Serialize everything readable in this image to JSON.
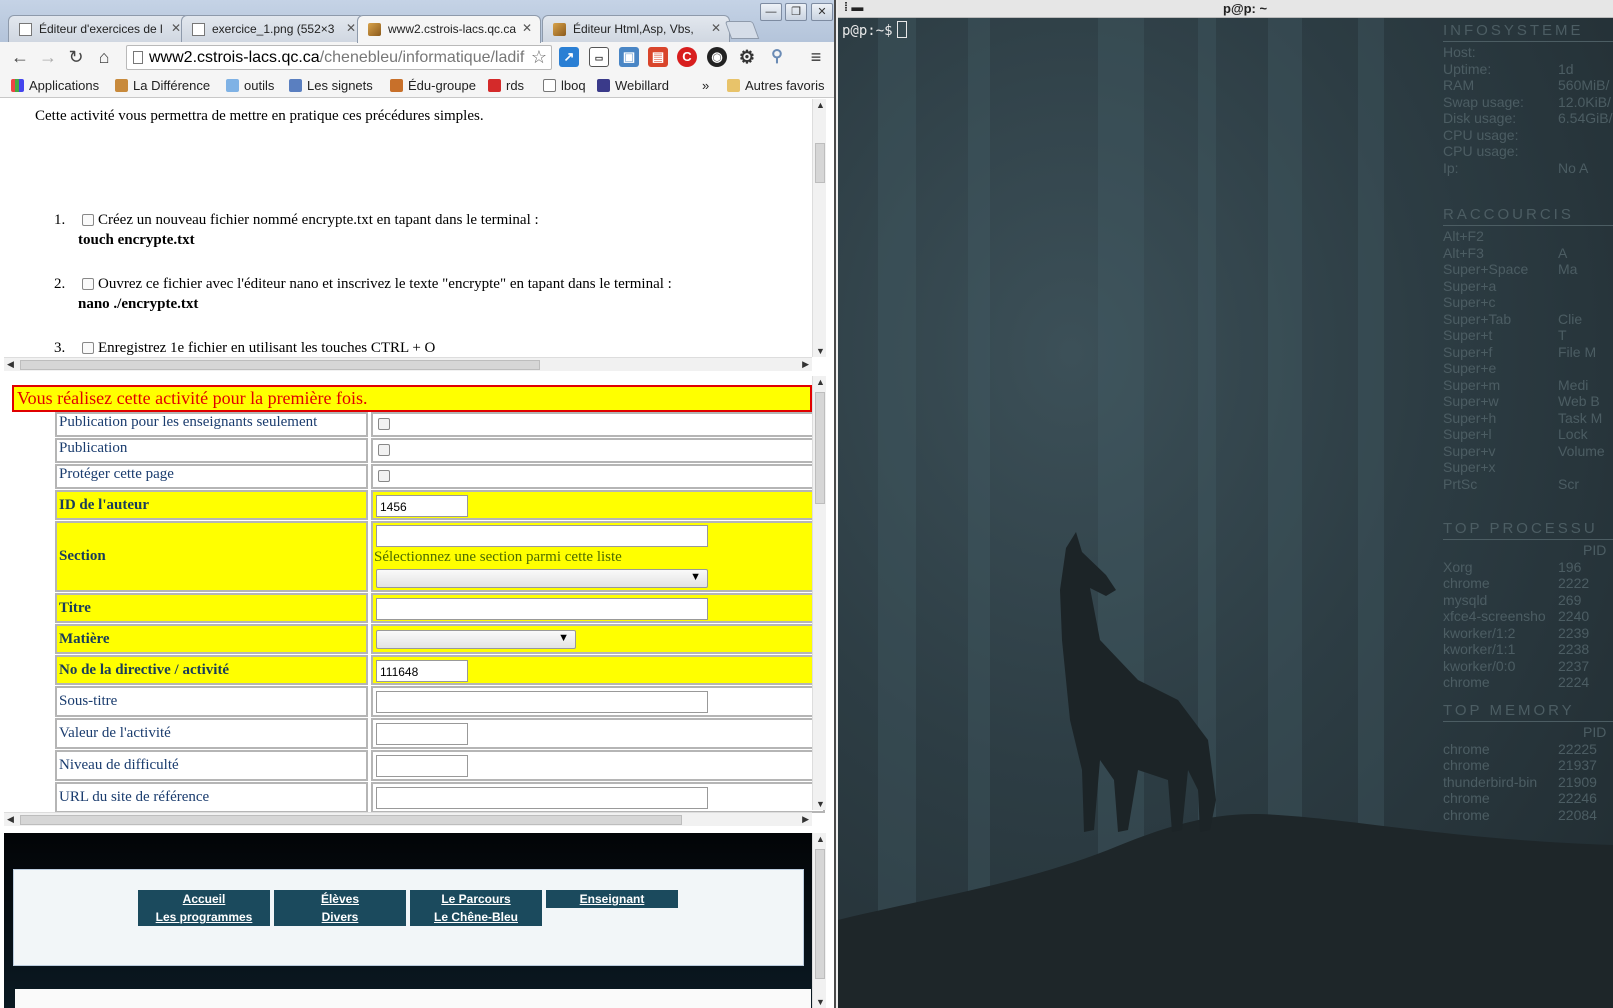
{
  "browser": {
    "tabs": [
      {
        "label": "Éditeur d'exercices de l"
      },
      {
        "label": "exercice_1.png (552×3"
      },
      {
        "label": "www2.cstrois-lacs.qc.ca"
      },
      {
        "label": "Éditeur Html,Asp, Vbs,"
      }
    ],
    "address": {
      "host": "www2.cstrois-lacs.qc.ca",
      "path": "/chenebleu/informatique/ladif"
    },
    "bookmarks": [
      {
        "label": "Applications"
      },
      {
        "label": "La Différence"
      },
      {
        "label": "outils"
      },
      {
        "label": "Les signets"
      },
      {
        "label": "Édu-groupe"
      },
      {
        "label": "rds"
      },
      {
        "label": "lboq"
      },
      {
        "label": "Webillard"
      }
    ],
    "bookmarks_overflow": "»",
    "other_bookmarks": "Autres favoris"
  },
  "frame1": {
    "intro": "Cette activité vous permettra de mettre en pratique ces précédures simples.",
    "steps": [
      {
        "num": "1.",
        "text": "Créez un nouveau fichier nommé encrypte.txt en tapant dans le terminal :",
        "cmd": "touch encrypte.txt"
      },
      {
        "num": "2.",
        "text": "Ouvrez ce fichier avec l'éditeur nano et inscrivez le texte \"encrypte\" en tapant dans le terminal :",
        "cmd": "nano ./encrypte.txt"
      },
      {
        "num": "3.",
        "text": "Enregistrez 1e fichier en utilisant les touches CTRL + O",
        "cmd": ""
      }
    ]
  },
  "frame2": {
    "status": "Vous réalisez cette activité pour la première fois.",
    "rows": {
      "pub_ens": "Publication pour les enseignants seulement",
      "pub": "Publication",
      "protect": "Protéger cette page",
      "author_id": "ID de l'auteur",
      "author_id_value": "1456",
      "section": "Section",
      "section_hint": "Sélectionnez une section parmi cette liste",
      "titre": "Titre",
      "matiere": "Matière",
      "directive": "No de la directive / activité",
      "directive_value": "111648",
      "sous_titre": "Sous-titre",
      "valeur": "Valeur de l'activité",
      "niveau": "Niveau de difficulté",
      "url": "URL du site de référence"
    }
  },
  "frame3": {
    "nav": [
      {
        "label": "Accueil"
      },
      {
        "label": "Élèves"
      },
      {
        "label": "Le Parcours"
      },
      {
        "label": "Enseignant"
      },
      {
        "label": "Les programmes"
      },
      {
        "label": "Divers"
      },
      {
        "label": "Le Chêne-Bleu"
      }
    ]
  },
  "terminal": {
    "title": "p@p: ~",
    "prompt": "p@p:~$"
  },
  "conky": {
    "info_header": "INFOSYSTEME",
    "info": [
      {
        "k": "Host:",
        "v": ""
      },
      {
        "k": "Uptime:",
        "v": "1d"
      },
      {
        "k": "RAM",
        "v": "560MiB/"
      },
      {
        "k": "Swap usage:",
        "v": "12.0KiB/"
      },
      {
        "k": "Disk usage:",
        "v": "6.54GiB/"
      },
      {
        "k": "CPU usage:",
        "v": ""
      },
      {
        "k": "CPU usage:",
        "v": ""
      },
      {
        "k": "Ip:",
        "v": "No A"
      }
    ],
    "shortcuts_header": "RACCOURCIS",
    "shortcuts": [
      {
        "k": "Alt+F2",
        "v": ""
      },
      {
        "k": "Alt+F3",
        "v": "A"
      },
      {
        "k": "Super+Space",
        "v": "Ma"
      },
      {
        "k": "Super+a",
        "v": ""
      },
      {
        "k": "Super+c",
        "v": ""
      },
      {
        "k": "Super+Tab",
        "v": "Clie"
      },
      {
        "k": "Super+t",
        "v": "T"
      },
      {
        "k": "Super+f",
        "v": "File M"
      },
      {
        "k": "Super+e",
        "v": ""
      },
      {
        "k": "Super+m",
        "v": "Medi"
      },
      {
        "k": "Super+w",
        "v": "Web B"
      },
      {
        "k": "Super+h",
        "v": "Task M"
      },
      {
        "k": "Super+l",
        "v": "Lock"
      },
      {
        "k": "Super+v",
        "v": "Volume"
      },
      {
        "k": "Super+x",
        "v": ""
      },
      {
        "k": "PrtSc",
        "v": "Scr"
      }
    ],
    "proc_header": "TOP PROCESSU",
    "proc_col": "PID",
    "procs": [
      {
        "k": "Xorg",
        "v": "196"
      },
      {
        "k": "chrome",
        "v": "2222"
      },
      {
        "k": "mysqld",
        "v": "269"
      },
      {
        "k": "xfce4-screensho",
        "v": "2240"
      },
      {
        "k": "kworker/1:2",
        "v": "2239"
      },
      {
        "k": "kworker/1:1",
        "v": "2238"
      },
      {
        "k": "kworker/0:0",
        "v": "2237"
      },
      {
        "k": "chrome",
        "v": "2224"
      }
    ],
    "mem_header": "TOP MEMORY",
    "mem_col": "PID",
    "mems": [
      {
        "k": "chrome",
        "v": "22225"
      },
      {
        "k": "chrome",
        "v": "21937"
      },
      {
        "k": "thunderbird-bin",
        "v": "21909"
      },
      {
        "k": "chrome",
        "v": "22246"
      },
      {
        "k": "chrome",
        "v": "22084"
      }
    ]
  }
}
